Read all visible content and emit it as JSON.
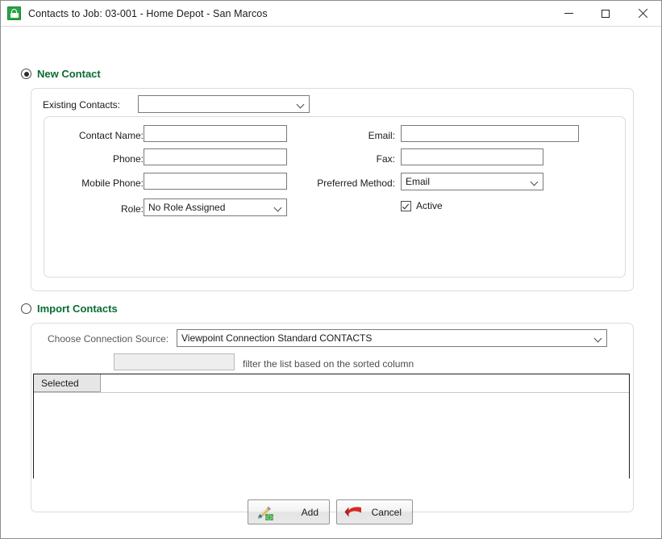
{
  "window": {
    "title": "Contacts to Job: 03-001 - Home Depot - San Marcos",
    "app_icon": "contacts-app-icon",
    "controls": {
      "minimize": "minimize-icon",
      "maximize": "maximize-icon",
      "close": "close-icon"
    }
  },
  "new_contact_section": {
    "label": "New Contact",
    "selected": true,
    "existing_contacts": {
      "label": "Existing Contacts:",
      "value": "",
      "placeholder": ""
    },
    "fields": {
      "contact_name": {
        "label": "Contact Name:",
        "value": ""
      },
      "phone": {
        "label": "Phone:",
        "value": ""
      },
      "mobile_phone": {
        "label": "Mobile Phone:",
        "value": ""
      },
      "role": {
        "label": "Role:",
        "value": "No Role Assigned"
      },
      "email": {
        "label": "Email:",
        "value": ""
      },
      "fax": {
        "label": "Fax:",
        "value": ""
      },
      "preferred_method": {
        "label": "Preferred Method:",
        "value": "Email"
      },
      "active": {
        "label": "Active",
        "checked": true
      }
    }
  },
  "import_contacts_section": {
    "label": "Import Contacts",
    "selected": false,
    "connection_source": {
      "label": "Choose Connection Source:",
      "value": "Viewpoint Connection Standard CONTACTS"
    },
    "filter": {
      "value": "",
      "hint": "filter the list based on the sorted column"
    },
    "grid": {
      "columns": [
        "Selected"
      ],
      "rows": []
    }
  },
  "footer": {
    "add_button": {
      "label": "Add",
      "icon": "pencil-add-icon"
    },
    "cancel_button": {
      "label": "Cancel",
      "icon": "red-back-arrow-icon"
    }
  },
  "colors": {
    "section_green": "#0a6b33",
    "window_bg": "#ffffff",
    "grid_header_bg": "#e6e6e6",
    "disabled_bg": "#eeeeee"
  }
}
